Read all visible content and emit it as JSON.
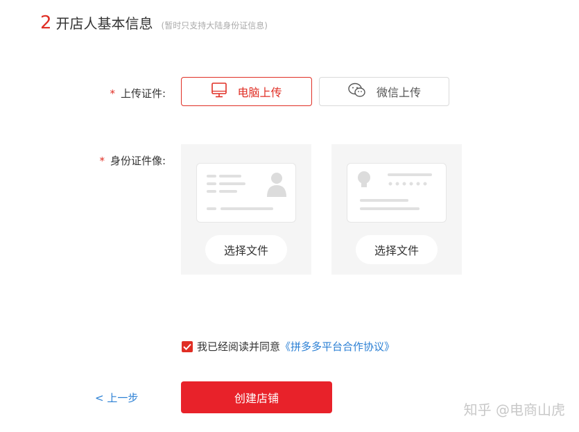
{
  "section": {
    "step_number": "2",
    "title": "开店人基本信息",
    "note": "(暂时只支持大陆身份证信息)"
  },
  "upload_id": {
    "required_mark": "*",
    "label": "上传证件:",
    "options": [
      {
        "label": "电脑上传",
        "icon": "monitor-icon",
        "selected": true
      },
      {
        "label": "微信上传",
        "icon": "wechat-icon",
        "selected": false
      }
    ]
  },
  "id_photos": {
    "required_mark": "*",
    "label": "身份证件像:",
    "cards": [
      {
        "side": "front",
        "button_label": "选择文件"
      },
      {
        "side": "back",
        "button_label": "选择文件"
      }
    ]
  },
  "agreement": {
    "checked": true,
    "text": "我已经阅读并同意",
    "link": "《拼多多平台合作协议》"
  },
  "footer": {
    "prev_label": "< 上一步",
    "submit_label": "创建店铺"
  },
  "watermark": "知乎 @电商山虎",
  "colors": {
    "accent": "#e02e24",
    "button": "#e8222a",
    "link": "#2a7fd4",
    "card_bg": "#f5f5f5"
  }
}
